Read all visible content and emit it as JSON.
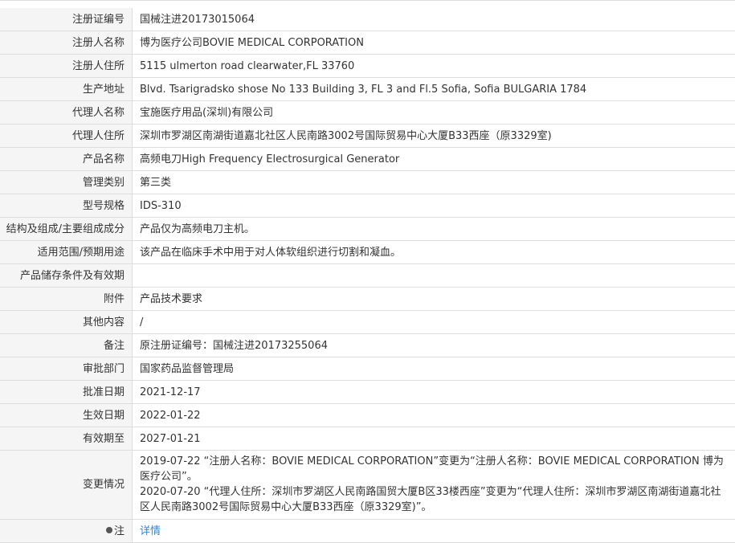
{
  "rows": [
    {
      "label": "注册证编号",
      "value": "国械注进20173015064"
    },
    {
      "label": "注册人名称",
      "value": "博为医疗公司BOVIE MEDICAL CORPORATION"
    },
    {
      "label": "注册人住所",
      "value": "5115 ulmerton road clearwater,FL 33760"
    },
    {
      "label": "生产地址",
      "value": "Blvd. Tsarigradsko shose No 133 Building 3, FL 3 and Fl.5 Sofia, Sofia BULGARIA 1784"
    },
    {
      "label": "代理人名称",
      "value": "宝施医疗用品(深圳)有限公司"
    },
    {
      "label": "代理人住所",
      "value": "深圳市罗湖区南湖街道嘉北社区人民南路3002号国际贸易中心大厦B33西座（原3329室)"
    },
    {
      "label": "产品名称",
      "value": "高频电刀High Frequency Electrosurgical Generator"
    },
    {
      "label": "管理类别",
      "value": "第三类"
    },
    {
      "label": "型号规格",
      "value": "IDS-310"
    },
    {
      "label": "结构及组成/主要组成成分",
      "value": "产品仅为高频电刀主机。"
    },
    {
      "label": "适用范围/预期用途",
      "value": "该产品在临床手术中用于对人体软组织进行切割和凝血。"
    },
    {
      "label": "产品储存条件及有效期",
      "value": ""
    },
    {
      "label": "附件",
      "value": "产品技术要求"
    },
    {
      "label": "其他内容",
      "value": "/"
    },
    {
      "label": "备注",
      "value": "原注册证编号：国械注进20173255064"
    },
    {
      "label": "审批部门",
      "value": "国家药品监督管理局"
    },
    {
      "label": "批准日期",
      "value": "2021-12-17"
    },
    {
      "label": "生效日期",
      "value": "2022-01-22"
    },
    {
      "label": "有效期至",
      "value": "2027-01-21"
    }
  ],
  "changes": {
    "label": "变更情况",
    "entries": [
      "2019-07-22 “注册人名称：BOVIE MEDICAL CORPORATION”变更为“注册人名称：BOVIE MEDICAL CORPORATION 博为医疗公司”。",
      "2020-07-20 “代理人住所：深圳市罗湖区人民南路国贸大厦B区33楼西座”变更为“代理人住所：深圳市罗湖区南湖街道嘉北社区人民南路3002号国际贸易中心大厦B33西座（原3329室)”。"
    ]
  },
  "note": {
    "label": "注",
    "icon": "pin-icon",
    "link_text": "详情",
    "link_color": "#3b82c4"
  }
}
